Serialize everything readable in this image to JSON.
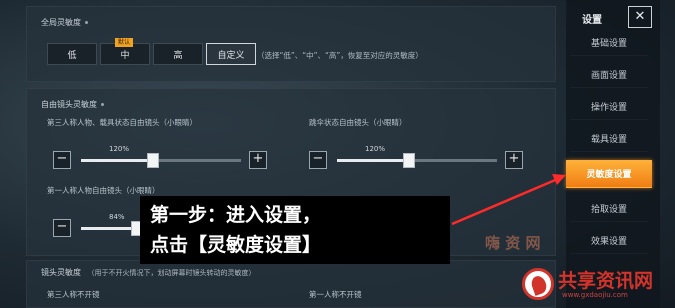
{
  "global_sensitivity": {
    "title": "全局灵敏度",
    "options": [
      {
        "label": "低",
        "badge": ""
      },
      {
        "label": "中",
        "badge": "默认"
      },
      {
        "label": "高",
        "badge": ""
      },
      {
        "label": "自定义",
        "badge": ""
      }
    ],
    "selected": "自定义",
    "hint": "（选择“低”、“中”、“高”，恢复至对应的灵敏度）"
  },
  "free_camera": {
    "title": "自由镜头灵敏度",
    "third_person_label": "第三人称人物、载具状态自由镜头（小眼睛）",
    "third_person_value": "120%",
    "third_person_fraction": 0.45,
    "parachute_label": "跳伞状态自由镜头（小眼睛）",
    "parachute_value": "120%",
    "parachute_fraction": 0.45,
    "first_person_label": "第一人称人物自由镜头（小眼睛）",
    "first_person_value": "84%",
    "first_person_fraction": 0.35
  },
  "camera": {
    "title": "镜头灵敏度",
    "subtitle": "（用于不开火情况下，划动屏幕时镜头转动的灵敏度）",
    "third_person_no_scope": "第三人称不开镜",
    "first_person_no_scope": "第一人称不开镜"
  },
  "sidebar": {
    "title": "设置",
    "close": "✕",
    "items": [
      "基础设置",
      "画面设置",
      "操作设置",
      "载具设置",
      "灵敏度设置",
      "拾取设置",
      "效果设置"
    ],
    "active_index": 4
  },
  "annotation": {
    "line1": "第一步：进入设置，",
    "line2": "点击【灵敏度设置】",
    "color": "#ff2a2a"
  },
  "watermark": {
    "name": "共享资讯网",
    "url": "www.gxdaojiu.com",
    "faded": "嗨 资 网"
  }
}
